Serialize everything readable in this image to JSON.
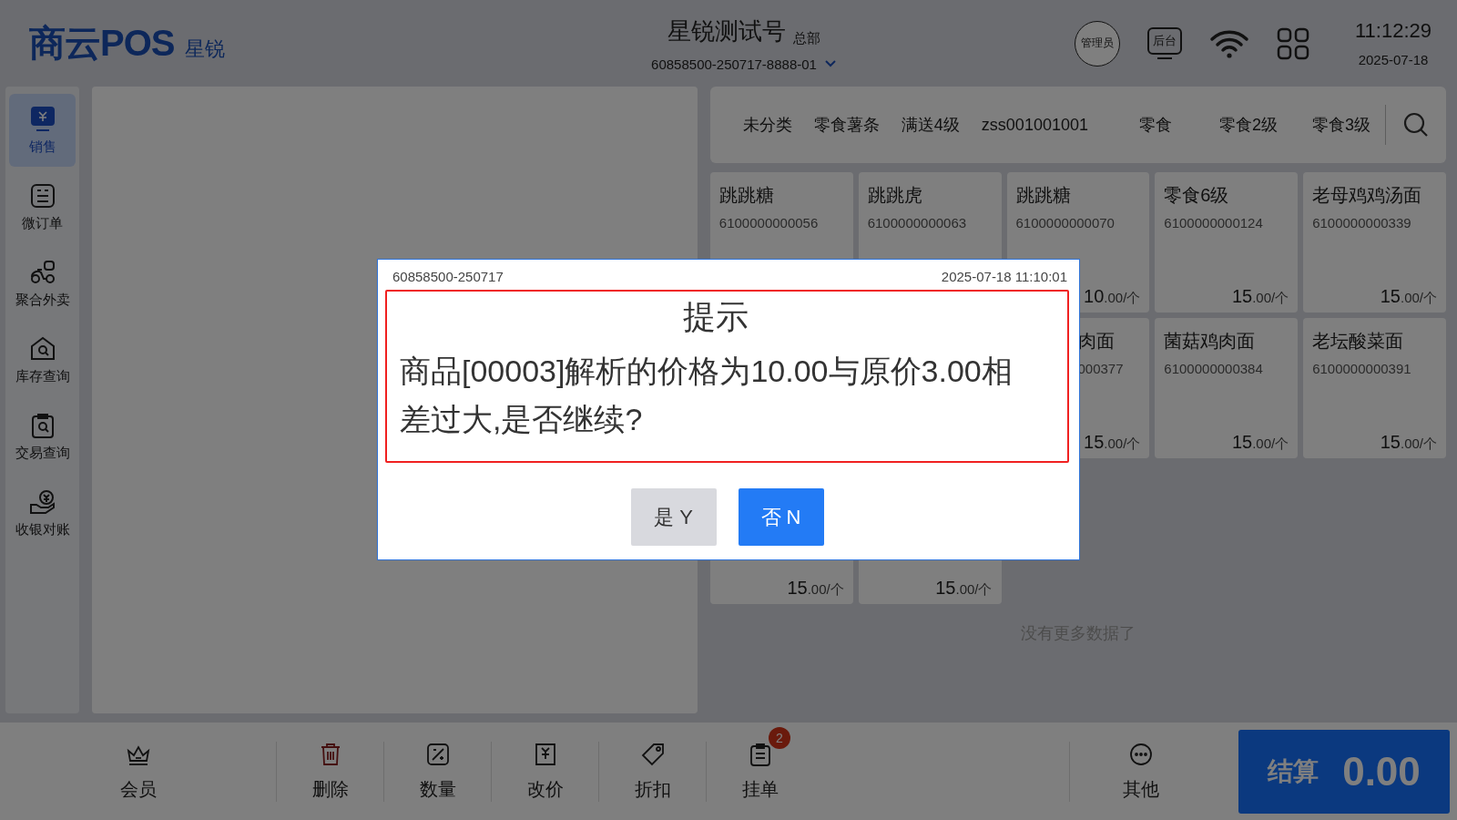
{
  "header": {
    "logo": "商云POS",
    "logo_sub": "星锐",
    "store_name": "星锐测试号",
    "store_tag": "总部",
    "device": "60858500-250717-8888-01",
    "buttons": [
      {
        "kind": "circle",
        "label": "管理员"
      },
      {
        "kind": "monitor",
        "label": "后台"
      },
      {
        "kind": "wifi"
      },
      {
        "kind": "apps"
      }
    ],
    "time": "11:12:29",
    "date": "2025-07-18"
  },
  "sidebar": {
    "items": [
      {
        "label": "销售",
        "selected": true
      },
      {
        "label": "微订单",
        "selected": false
      },
      {
        "label": "聚合外卖",
        "selected": false
      },
      {
        "label": "库存查询",
        "selected": false
      },
      {
        "label": "交易查询",
        "selected": false
      },
      {
        "label": "收银对账",
        "selected": false
      }
    ]
  },
  "categories": [
    "未分类",
    "零食薯条",
    "满送4级",
    "zss001001001",
    "零食",
    "零食2级",
    "零食3级"
  ],
  "products": [
    {
      "name": "跳跳糖",
      "code": "6100000000056"
    },
    {
      "name": "跳跳虎",
      "code": "6100000000063"
    },
    {
      "name": "跳跳糖",
      "code": "6100000000070",
      "price": "10",
      "decimals": ".00",
      "unit": "/个"
    },
    {
      "name": "零食6级",
      "code": "6100000000124",
      "price": "15",
      "decimals": ".00",
      "unit": "/个"
    },
    {
      "name": "老母鸡鸡汤面",
      "code": "6100000000339",
      "price": "15",
      "decimals": ".00",
      "unit": "/个"
    },
    {
      "name": "肉面",
      "code": "000377",
      "price": "15",
      "decimals": ".00",
      "unit": "/个",
      "cut": true
    },
    {
      "name": "菌菇鸡肉面",
      "code": "6100000000384",
      "price": "15",
      "decimals": ".00",
      "unit": "/个"
    },
    {
      "name": "老坛酸菜面",
      "code": "6100000000391",
      "price": "15",
      "decimals": ".00",
      "unit": "/个"
    },
    {
      "price": "15",
      "decimals": ".00",
      "unit": "/个"
    },
    {
      "price": "15",
      "decimals": ".00",
      "unit": "/个"
    }
  ],
  "empty_note": "没有更多数据了",
  "toolbar": {
    "items": [
      {
        "label": "会员"
      },
      {
        "label": "删除"
      },
      {
        "label": "数量"
      },
      {
        "label": "改价"
      },
      {
        "label": "折扣"
      },
      {
        "label": "挂单",
        "badge": "2"
      },
      {
        "label": "其他"
      }
    ],
    "checkout_label": "结算",
    "total": "0.00"
  },
  "dialog": {
    "id": "60858500-250717",
    "time": "2025-07-18 11:10:01",
    "title": "提示",
    "message": "商品[00003]解析的价格为10.00与原价3.00相差过大,是否继续?",
    "buttons": [
      {
        "label": "是 Y",
        "kind": "secondary"
      },
      {
        "label": "否 N",
        "kind": "primary"
      }
    ]
  }
}
